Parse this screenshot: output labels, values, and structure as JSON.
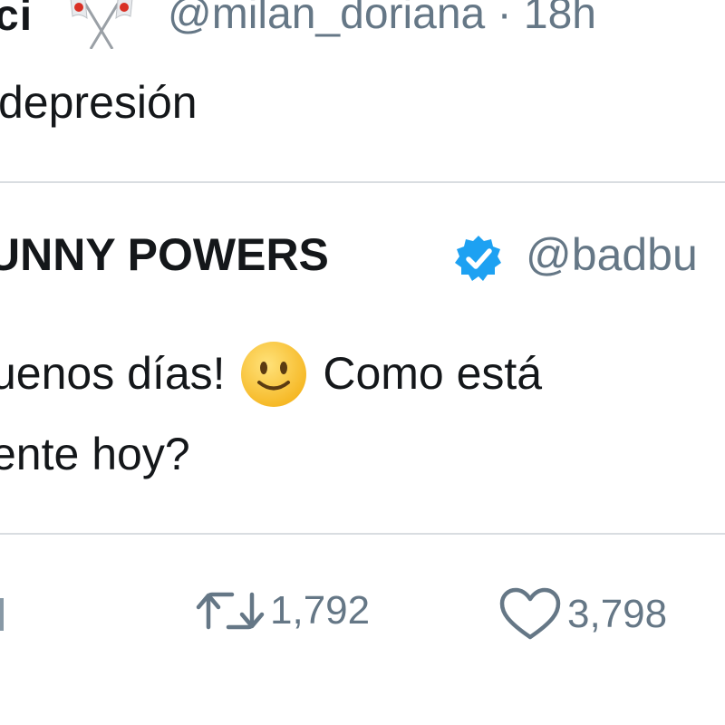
{
  "tweet": {
    "display_name": "ci",
    "handle": "@milan_doriana · 18h",
    "text": "depresión",
    "flag_icon": "crossed-flags-icon"
  },
  "quoted_tweet": {
    "display_name": "UNNY POWERS",
    "verified_icon": "verified-badge-icon",
    "handle": "@badbu",
    "line1_start": "uenos días!",
    "emoji": "slightly-smiling-face-emoji",
    "line1_end": "Como está",
    "line2": "ente hoy?"
  },
  "actions": {
    "retweet_icon": "retweet-icon",
    "retweet_count": "1,792",
    "like_icon": "heart-icon",
    "like_count": "3,798"
  },
  "colors": {
    "text": "#14171a",
    "secondary": "#657786",
    "verified": "#1da1f2",
    "divider": "#d9dde1",
    "emoji": "#ffcc4d"
  }
}
